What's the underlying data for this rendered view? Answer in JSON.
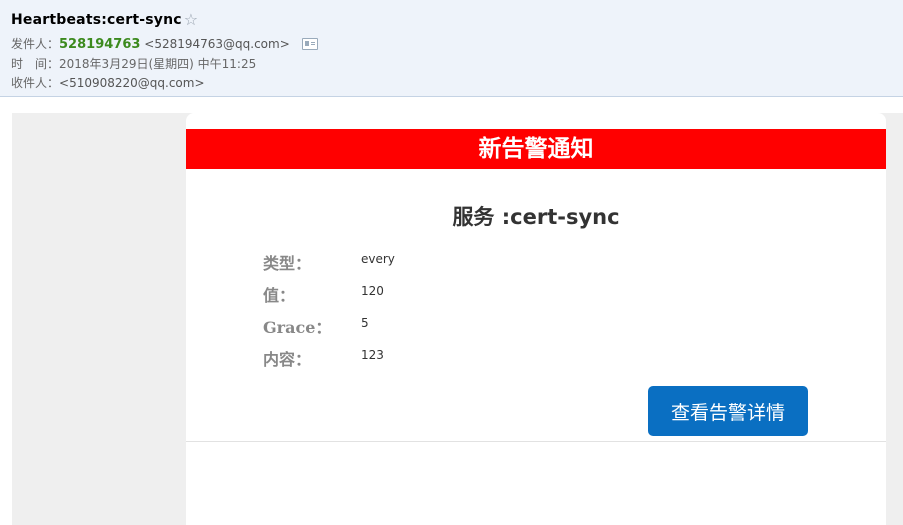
{
  "header": {
    "subject": "Heartbeats:cert-sync",
    "star_icon": "☆",
    "from_label": "发件人：",
    "from_name": "528194763",
    "from_address": "<528194763@qq.com>",
    "time_label": "时　间：",
    "time_value": "2018年3月29日(星期四) 中午11:25",
    "to_label": "收件人：",
    "to_address": "<510908220@qq.com>"
  },
  "email": {
    "banner": "新告警通知",
    "service_title": "服务 :cert-sync",
    "fields": [
      {
        "label": "类型：",
        "value": "every"
      },
      {
        "label": "值：",
        "value": "120"
      },
      {
        "label": "Grace：",
        "value": "5"
      },
      {
        "label": "内容：",
        "value": "123"
      }
    ],
    "button_label": "查看告警详情"
  },
  "colors": {
    "banner": "#ff0000",
    "button": "#0a6fc2",
    "sender_name": "#3c8a1e",
    "header_bg": "#eef3fa"
  }
}
